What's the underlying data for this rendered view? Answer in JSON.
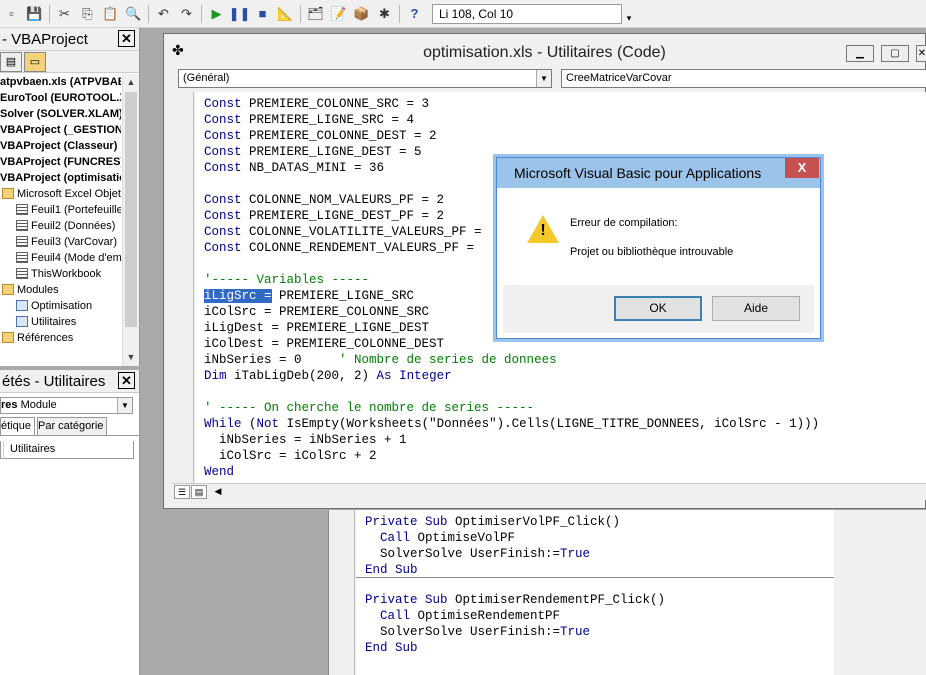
{
  "toolbar": {
    "status_text": "Li 108, Col 10",
    "icons": [
      "save-icon",
      "cut-icon",
      "copy-icon",
      "paste-icon",
      "find-icon",
      "undo-icon",
      "redo-icon",
      "run-icon",
      "pause-icon",
      "stop-icon",
      "design-mode-icon",
      "project-explorer-icon",
      "properties-icon",
      "object-browser-icon",
      "toolbox-icon",
      "help-icon"
    ]
  },
  "project_panel": {
    "title": "- VBAProject",
    "tree": [
      {
        "label": "atpvbaen.xls (ATPVBAEN.XLAM)",
        "bold": true,
        "indent": 0,
        "icon": "project"
      },
      {
        "label": "EuroTool (EUROTOOL.XLAM)",
        "bold": true,
        "indent": 0,
        "icon": "project"
      },
      {
        "label": "Solver (SOLVER.XLAM)",
        "bold": true,
        "indent": 0,
        "icon": "project"
      },
      {
        "label": "VBAProject (_GESTION)",
        "bold": true,
        "indent": 0,
        "icon": "project"
      },
      {
        "label": "VBAProject (Classeur)",
        "bold": true,
        "indent": 0,
        "icon": "project"
      },
      {
        "label": "VBAProject (FUNCRES)",
        "bold": true,
        "indent": 0,
        "icon": "project"
      },
      {
        "label": "VBAProject (optimisation)",
        "bold": true,
        "indent": 0,
        "icon": "project"
      },
      {
        "label": "Microsoft Excel Objets",
        "bold": false,
        "indent": 1,
        "icon": "folder"
      },
      {
        "label": "Feuil1 (Portefeuille)",
        "bold": false,
        "indent": 2,
        "icon": "sheet"
      },
      {
        "label": "Feuil2 (Données)",
        "bold": false,
        "indent": 2,
        "icon": "sheet"
      },
      {
        "label": "Feuil3 (VarCovar)",
        "bold": false,
        "indent": 2,
        "icon": "sheet"
      },
      {
        "label": "Feuil4 (Mode d'emploi)",
        "bold": false,
        "indent": 2,
        "icon": "sheet"
      },
      {
        "label": "ThisWorkbook",
        "bold": false,
        "indent": 2,
        "icon": "sheet"
      },
      {
        "label": "Modules",
        "bold": false,
        "indent": 1,
        "icon": "folder"
      },
      {
        "label": "Optimisation",
        "bold": false,
        "indent": 2,
        "icon": "module"
      },
      {
        "label": "Utilitaires",
        "bold": false,
        "indent": 2,
        "icon": "module"
      },
      {
        "label": "Références",
        "bold": false,
        "indent": 1,
        "icon": "folder"
      }
    ]
  },
  "properties_panel": {
    "title": "étés - Utilitaires",
    "object_name": "res",
    "object_type": "Module",
    "tab_alpha": "étique",
    "tab_category": "Par catégorie",
    "grid_value": "Utilitaires"
  },
  "code_window": {
    "title": "optimisation.xls - Utilitaires (Code)",
    "combo_object": "(Général)",
    "combo_proc": "CreeMatriceVarCovar",
    "lines": [
      [
        {
          "t": "Const",
          "c": "kw"
        },
        {
          "t": " PREMIERE_COLONNE_SRC = 3"
        }
      ],
      [
        {
          "t": "Const",
          "c": "kw"
        },
        {
          "t": " PREMIERE_LIGNE_SRC = 4"
        }
      ],
      [
        {
          "t": "Const",
          "c": "kw"
        },
        {
          "t": " PREMIERE_COLONNE_DEST = 2"
        }
      ],
      [
        {
          "t": "Const",
          "c": "kw"
        },
        {
          "t": " PREMIERE_LIGNE_DEST = 5"
        }
      ],
      [
        {
          "t": "Const",
          "c": "kw"
        },
        {
          "t": " NB_DATAS_MINI = 36"
        }
      ],
      [
        {
          "t": ""
        }
      ],
      [
        {
          "t": "Const",
          "c": "kw"
        },
        {
          "t": " COLONNE_NOM_VALEURS_PF = 2"
        }
      ],
      [
        {
          "t": "Const",
          "c": "kw"
        },
        {
          "t": " PREMIERE_LIGNE_DEST_PF = 2"
        }
      ],
      [
        {
          "t": "Const",
          "c": "kw"
        },
        {
          "t": " COLONNE_VOLATILITE_VALEURS_PF = "
        }
      ],
      [
        {
          "t": "Const",
          "c": "kw"
        },
        {
          "t": " COLONNE_RENDEMENT_VALEURS_PF = "
        }
      ],
      [
        {
          "t": ""
        }
      ],
      [
        {
          "t": "'----- Variables -----",
          "c": "cm"
        }
      ],
      [
        {
          "t": "iLigSrc =",
          "c": "sel"
        },
        {
          "t": " PREMIERE_LIGNE_SRC"
        }
      ],
      [
        {
          "t": "iColSrc = PREMIERE_COLONNE_SRC"
        }
      ],
      [
        {
          "t": "iLigDest = PREMIERE_LIGNE_DEST"
        }
      ],
      [
        {
          "t": "iColDest = PREMIERE_COLONNE_DEST"
        }
      ],
      [
        {
          "t": "iNbSeries = 0     "
        },
        {
          "t": "' Nombre de series de donnees",
          "c": "cm"
        }
      ],
      [
        {
          "t": "Dim",
          "c": "kw"
        },
        {
          "t": " iTabLigDeb(200, 2) "
        },
        {
          "t": "As",
          "c": "kw"
        },
        {
          "t": " "
        },
        {
          "t": "Integer",
          "c": "kw"
        }
      ],
      [
        {
          "t": ""
        }
      ],
      [
        {
          "t": "' ----- On cherche le nombre de series -----",
          "c": "cm"
        }
      ],
      [
        {
          "t": "While",
          "c": "kw"
        },
        {
          "t": " ("
        },
        {
          "t": "Not",
          "c": "kw"
        },
        {
          "t": " IsEmpty(Worksheets(\"Données\").Cells(LIGNE_TITRE_DONNEES, iColSrc - 1)))"
        }
      ],
      [
        {
          "t": "  iNbSeries = iNbSeries + 1"
        }
      ],
      [
        {
          "t": "  iColSrc = iColSrc + 2"
        }
      ],
      [
        {
          "t": "Wend",
          "c": "kw"
        }
      ]
    ]
  },
  "background_code": {
    "lines": [
      [
        {
          "t": "Private Sub",
          "c": "kw"
        },
        {
          "t": " OptimiserVolPF_Click()"
        }
      ],
      [
        {
          "t": "  "
        },
        {
          "t": "Call",
          "c": "kw"
        },
        {
          "t": " OptimiseVolPF"
        }
      ],
      [
        {
          "t": "  SolverSolve UserFinish:="
        },
        {
          "t": "True",
          "c": "kw"
        }
      ],
      [
        {
          "t": "End Sub",
          "c": "kw"
        }
      ],
      [
        {
          "t": "",
          "sep": true
        }
      ],
      [
        {
          "t": "Private Sub",
          "c": "kw"
        },
        {
          "t": " OptimiserRendementPF_Click()"
        }
      ],
      [
        {
          "t": "  "
        },
        {
          "t": "Call",
          "c": "kw"
        },
        {
          "t": " OptimiseRendementPF"
        }
      ],
      [
        {
          "t": "  SolverSolve UserFinish:="
        },
        {
          "t": "True",
          "c": "kw"
        }
      ],
      [
        {
          "t": "End Sub",
          "c": "kw"
        }
      ]
    ]
  },
  "dialog": {
    "title": "Microsoft Visual Basic pour Applications",
    "message_title": "Erreur de compilation:",
    "message_body": "Projet ou bibliothèque introuvable",
    "ok_label": "OK",
    "help_label": "Aide",
    "close_label": "X"
  },
  "colors": {
    "keyword": "#00008b",
    "comment": "#008000",
    "selection": "#316ac5",
    "dialog_title_bg": "#9cc3ea",
    "close_button": "#c75050"
  }
}
